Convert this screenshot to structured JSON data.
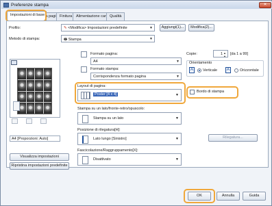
{
  "window": {
    "title": "Preferenze stampa",
    "close_label": "✕"
  },
  "tabs": [
    {
      "label": "Impostazioni di base",
      "active": true
    },
    {
      "label": "Imposta pagina",
      "active": false
    },
    {
      "label": "Finitura",
      "active": false
    },
    {
      "label": "Alimentazione carta",
      "active": false
    },
    {
      "label": "Qualità",
      "active": false
    }
  ],
  "profile": {
    "label": "Profilo:",
    "value": "<Modifica> Impostazioni predefinite",
    "add_button": "Aggiungi(1)...",
    "edit_button": "Modifica(2)..."
  },
  "output_method": {
    "label": "Metodo di stampa:",
    "value": "Stampa"
  },
  "page_size": {
    "label": "Formato pagina:",
    "value": "A4"
  },
  "output_size": {
    "label": "Formato stampa:",
    "value": "Corrispondenza formato pagina"
  },
  "copies": {
    "label": "Copie:",
    "value": "1",
    "range": "[da 1 a 99]"
  },
  "orientation": {
    "label": "Orientamento",
    "portrait": "Verticale",
    "landscape": "Orizzontale",
    "selected": "portrait"
  },
  "page_layout": {
    "label": "Layout di pagina:",
    "value": "Poster [4 x 4]"
  },
  "page_border": {
    "label": "Bordo di stampa",
    "checked": false
  },
  "preview_caption": "A4 [Proporzioni: Auto]",
  "duplex": {
    "label": "Stampa su un lato/fronte-retro/opuscolo:",
    "value": "Stampa su un lato"
  },
  "binding": {
    "label": "Posizione di rilegatura[H]:",
    "value": "Lato lungo [Sinistro]",
    "button": "Rilegatura..."
  },
  "finishing": {
    "label": "Fascicolazione/Raggruppamento[X]:",
    "value": "Disattivato"
  },
  "side_buttons": {
    "view_settings": "Visualizza impostazioni",
    "restore_defaults": "Ripristina impostazioni predefinite"
  },
  "footer": {
    "ok": "OK",
    "cancel": "Annulla",
    "help": "Guida"
  },
  "colors": {
    "highlight": "#f0a73a",
    "window_bg": "#f0f3f8",
    "accent": "#1e4f9a"
  }
}
